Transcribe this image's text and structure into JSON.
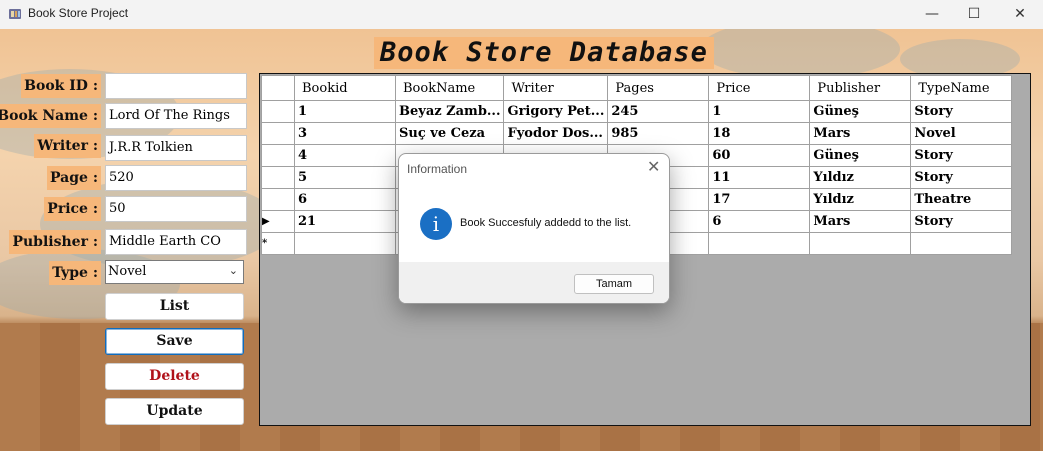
{
  "window": {
    "title": "Book Store Project",
    "controls": {
      "minimize": "—",
      "maximize": "☐",
      "close": "✕"
    }
  },
  "app_title": "Book Store Database",
  "form": {
    "book_id": {
      "label": "Book ID :",
      "value": ""
    },
    "book_name": {
      "label": "Book Name :",
      "value": "Lord Of The Rings"
    },
    "writer": {
      "label": "Writer :",
      "value": "J.R.R Tolkien"
    },
    "page": {
      "label": "Page :",
      "value": "520"
    },
    "price": {
      "label": "Price :",
      "value": "50"
    },
    "publisher": {
      "label": "Publisher :",
      "value": "Middle Earth CO"
    },
    "type": {
      "label": "Type :",
      "value": "Novel"
    }
  },
  "buttons": {
    "list": "List",
    "save": "Save",
    "delete": "Delete",
    "update": "Update"
  },
  "grid": {
    "columns": [
      "Bookid",
      "BookName",
      "Writer",
      "Pages",
      "Price",
      "Publisher",
      "TypeName"
    ],
    "rows": [
      {
        "marker": "",
        "cells": [
          "1",
          "Beyaz Zamb...",
          "Grigory Pet...",
          "245",
          "1",
          "Güneş",
          "Story"
        ]
      },
      {
        "marker": "",
        "cells": [
          "3",
          "Suç ve Ceza",
          "Fyodor Dos...",
          "985",
          "18",
          "Mars",
          "Novel"
        ]
      },
      {
        "marker": "",
        "cells": [
          "4",
          "",
          "",
          "",
          "60",
          "Güneş",
          "Story"
        ]
      },
      {
        "marker": "",
        "cells": [
          "5",
          "",
          "",
          "",
          "11",
          "Yıldız",
          "Story"
        ]
      },
      {
        "marker": "",
        "cells": [
          "6",
          "",
          "",
          "",
          "17",
          "Yıldız",
          "Theatre"
        ]
      },
      {
        "marker": "▶",
        "cells": [
          "21",
          "",
          "",
          "",
          "6",
          "Mars",
          "Story"
        ]
      },
      {
        "marker": "*",
        "cells": [
          "",
          "",
          "",
          "",
          "",
          "",
          ""
        ]
      }
    ]
  },
  "dialog": {
    "title": "Information",
    "message": "Book Succesfuly addedd to the list.",
    "ok_label": "Tamam",
    "icon": "info-icon",
    "close": "✕"
  }
}
